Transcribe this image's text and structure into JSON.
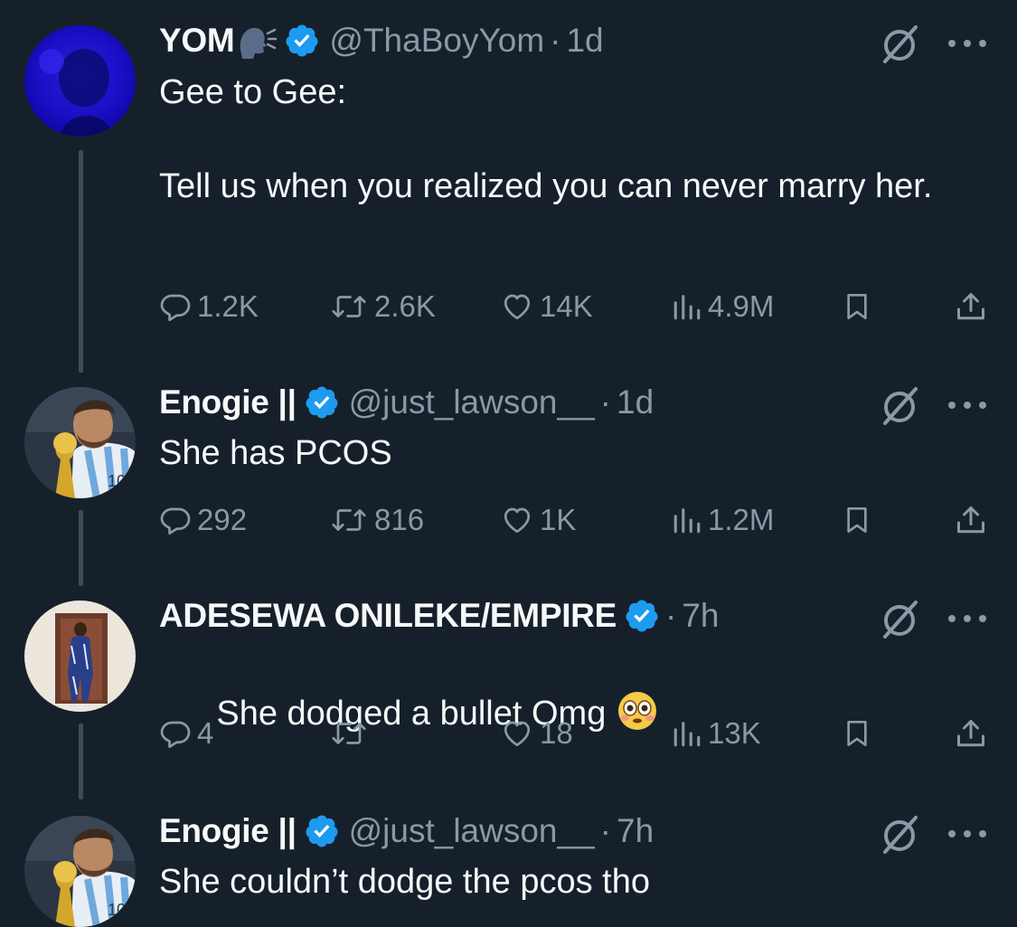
{
  "tweets": [
    {
      "display_name": "YOM",
      "handle": "@ThaBoyYom",
      "separator": "·",
      "time": "1d",
      "text": "Gee to Gee:\n\nTell us when you realized you can never marry her.",
      "replies": "1.2K",
      "reposts": "2.6K",
      "likes": "14K",
      "views": "4.9M",
      "has_speaking_emoji": true
    },
    {
      "display_name": "Enogie ||",
      "handle": "@just_lawson__",
      "separator": "·",
      "time": "1d",
      "text": "She has PCOS",
      "replies": "292",
      "reposts": "816",
      "likes": "1K",
      "views": "1.2M"
    },
    {
      "display_name": "ADESEWA ONILEKE/EMPIRE",
      "handle": "",
      "separator": "·",
      "time": "7h",
      "text": "She dodged a bullet Omg",
      "trailing_emoji": "flushed-face-emoji",
      "replies": "4",
      "reposts": "",
      "likes": "18",
      "views": "13K"
    },
    {
      "display_name": "Enogie ||",
      "handle": "@just_lawson__",
      "separator": "·",
      "time": "7h",
      "text": "She couldn’t dodge the pcos tho"
    }
  ],
  "icons": {
    "verified": "verified-badge-icon",
    "grok": "grok-icon",
    "more": "more-icon",
    "reply": "reply-icon",
    "repost": "repost-icon",
    "like": "like-icon",
    "views": "views-icon",
    "bookmark": "bookmark-icon",
    "share": "share-icon"
  },
  "colors": {
    "background": "#15202b",
    "text_primary": "#f7f9f9",
    "text_secondary": "#8b98a5",
    "verified_blue": "#1d9bf0",
    "thread_line": "#3e4c5a"
  }
}
